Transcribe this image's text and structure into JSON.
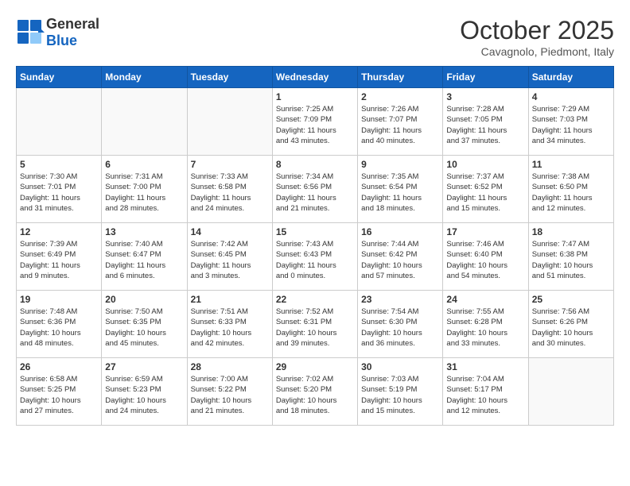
{
  "header": {
    "logo_general": "General",
    "logo_blue": "Blue",
    "month_title": "October 2025",
    "subtitle": "Cavagnolo, Piedmont, Italy"
  },
  "days_of_week": [
    "Sunday",
    "Monday",
    "Tuesday",
    "Wednesday",
    "Thursday",
    "Friday",
    "Saturday"
  ],
  "weeks": [
    [
      {
        "day": "",
        "info": ""
      },
      {
        "day": "",
        "info": ""
      },
      {
        "day": "",
        "info": ""
      },
      {
        "day": "1",
        "info": "Sunrise: 7:25 AM\nSunset: 7:09 PM\nDaylight: 11 hours\nand 43 minutes."
      },
      {
        "day": "2",
        "info": "Sunrise: 7:26 AM\nSunset: 7:07 PM\nDaylight: 11 hours\nand 40 minutes."
      },
      {
        "day": "3",
        "info": "Sunrise: 7:28 AM\nSunset: 7:05 PM\nDaylight: 11 hours\nand 37 minutes."
      },
      {
        "day": "4",
        "info": "Sunrise: 7:29 AM\nSunset: 7:03 PM\nDaylight: 11 hours\nand 34 minutes."
      }
    ],
    [
      {
        "day": "5",
        "info": "Sunrise: 7:30 AM\nSunset: 7:01 PM\nDaylight: 11 hours\nand 31 minutes."
      },
      {
        "day": "6",
        "info": "Sunrise: 7:31 AM\nSunset: 7:00 PM\nDaylight: 11 hours\nand 28 minutes."
      },
      {
        "day": "7",
        "info": "Sunrise: 7:33 AM\nSunset: 6:58 PM\nDaylight: 11 hours\nand 24 minutes."
      },
      {
        "day": "8",
        "info": "Sunrise: 7:34 AM\nSunset: 6:56 PM\nDaylight: 11 hours\nand 21 minutes."
      },
      {
        "day": "9",
        "info": "Sunrise: 7:35 AM\nSunset: 6:54 PM\nDaylight: 11 hours\nand 18 minutes."
      },
      {
        "day": "10",
        "info": "Sunrise: 7:37 AM\nSunset: 6:52 PM\nDaylight: 11 hours\nand 15 minutes."
      },
      {
        "day": "11",
        "info": "Sunrise: 7:38 AM\nSunset: 6:50 PM\nDaylight: 11 hours\nand 12 minutes."
      }
    ],
    [
      {
        "day": "12",
        "info": "Sunrise: 7:39 AM\nSunset: 6:49 PM\nDaylight: 11 hours\nand 9 minutes."
      },
      {
        "day": "13",
        "info": "Sunrise: 7:40 AM\nSunset: 6:47 PM\nDaylight: 11 hours\nand 6 minutes."
      },
      {
        "day": "14",
        "info": "Sunrise: 7:42 AM\nSunset: 6:45 PM\nDaylight: 11 hours\nand 3 minutes."
      },
      {
        "day": "15",
        "info": "Sunrise: 7:43 AM\nSunset: 6:43 PM\nDaylight: 11 hours\nand 0 minutes."
      },
      {
        "day": "16",
        "info": "Sunrise: 7:44 AM\nSunset: 6:42 PM\nDaylight: 10 hours\nand 57 minutes."
      },
      {
        "day": "17",
        "info": "Sunrise: 7:46 AM\nSunset: 6:40 PM\nDaylight: 10 hours\nand 54 minutes."
      },
      {
        "day": "18",
        "info": "Sunrise: 7:47 AM\nSunset: 6:38 PM\nDaylight: 10 hours\nand 51 minutes."
      }
    ],
    [
      {
        "day": "19",
        "info": "Sunrise: 7:48 AM\nSunset: 6:36 PM\nDaylight: 10 hours\nand 48 minutes."
      },
      {
        "day": "20",
        "info": "Sunrise: 7:50 AM\nSunset: 6:35 PM\nDaylight: 10 hours\nand 45 minutes."
      },
      {
        "day": "21",
        "info": "Sunrise: 7:51 AM\nSunset: 6:33 PM\nDaylight: 10 hours\nand 42 minutes."
      },
      {
        "day": "22",
        "info": "Sunrise: 7:52 AM\nSunset: 6:31 PM\nDaylight: 10 hours\nand 39 minutes."
      },
      {
        "day": "23",
        "info": "Sunrise: 7:54 AM\nSunset: 6:30 PM\nDaylight: 10 hours\nand 36 minutes."
      },
      {
        "day": "24",
        "info": "Sunrise: 7:55 AM\nSunset: 6:28 PM\nDaylight: 10 hours\nand 33 minutes."
      },
      {
        "day": "25",
        "info": "Sunrise: 7:56 AM\nSunset: 6:26 PM\nDaylight: 10 hours\nand 30 minutes."
      }
    ],
    [
      {
        "day": "26",
        "info": "Sunrise: 6:58 AM\nSunset: 5:25 PM\nDaylight: 10 hours\nand 27 minutes."
      },
      {
        "day": "27",
        "info": "Sunrise: 6:59 AM\nSunset: 5:23 PM\nDaylight: 10 hours\nand 24 minutes."
      },
      {
        "day": "28",
        "info": "Sunrise: 7:00 AM\nSunset: 5:22 PM\nDaylight: 10 hours\nand 21 minutes."
      },
      {
        "day": "29",
        "info": "Sunrise: 7:02 AM\nSunset: 5:20 PM\nDaylight: 10 hours\nand 18 minutes."
      },
      {
        "day": "30",
        "info": "Sunrise: 7:03 AM\nSunset: 5:19 PM\nDaylight: 10 hours\nand 15 minutes."
      },
      {
        "day": "31",
        "info": "Sunrise: 7:04 AM\nSunset: 5:17 PM\nDaylight: 10 hours\nand 12 minutes."
      },
      {
        "day": "",
        "info": ""
      }
    ]
  ]
}
